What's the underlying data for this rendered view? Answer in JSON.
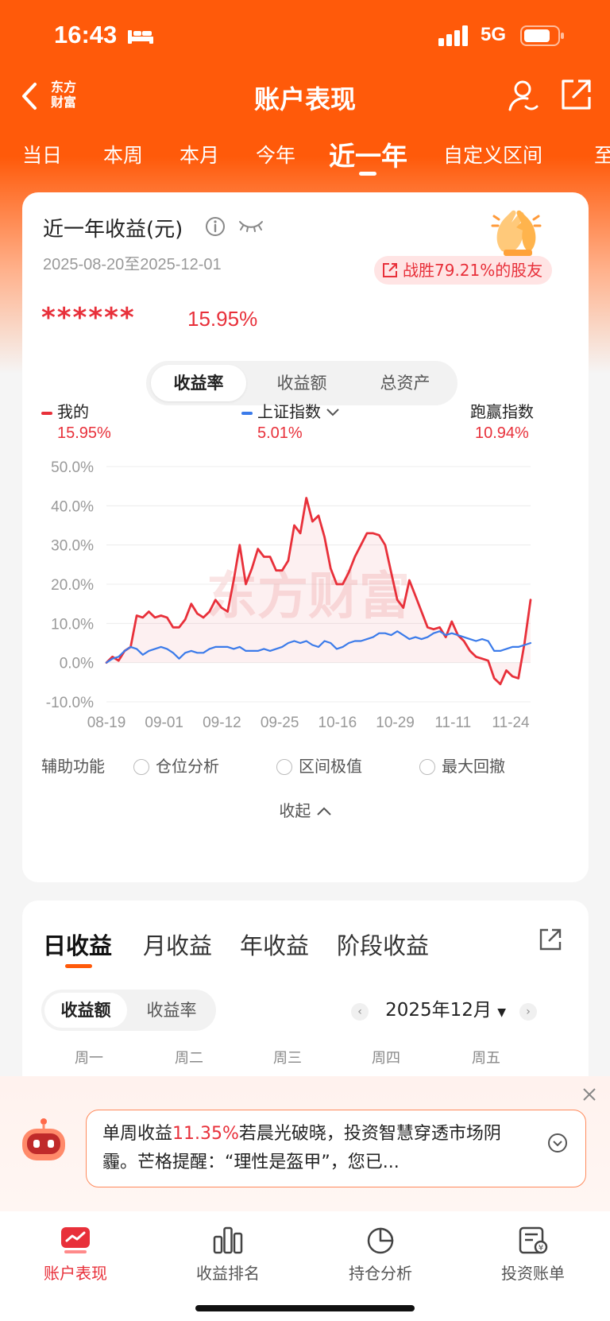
{
  "status_bar": {
    "time": "16:43",
    "network": "5G"
  },
  "nav": {
    "logo": "东方\n财富",
    "title": "账户表现"
  },
  "period_tabs": [
    "当日",
    "本周",
    "本月",
    "今年",
    "近一年",
    "自定义区间",
    "至"
  ],
  "active_period": "近一年",
  "summary": {
    "title": "近一年收益(元)",
    "date_range": "2025-08-20至2025-12-01",
    "win_badge": "战胜79.21%的股友",
    "hidden_amount": "******",
    "return_rate": "15.95%"
  },
  "metric_tabs": [
    "收益率",
    "收益额",
    "总资产"
  ],
  "legend": {
    "mine_label": "我的",
    "mine_value": "15.95%",
    "index_label": "上证指数",
    "index_value": "5.01%",
    "beat_label": "跑赢指数",
    "beat_value": "10.94%"
  },
  "chart_data": {
    "type": "line",
    "yticks": [
      "50.0%",
      "40.0%",
      "30.0%",
      "20.0%",
      "10.0%",
      "0.0%",
      "-10.0%"
    ],
    "xticks": [
      "08-19",
      "09-01",
      "09-12",
      "09-25",
      "10-16",
      "10-29",
      "11-11",
      "11-24"
    ],
    "ylim": [
      -10,
      50
    ],
    "watermark": "东方财富",
    "series": [
      {
        "name": "我的",
        "color": "#e8303a",
        "values": [
          0,
          1.5,
          0.5,
          3,
          4,
          12,
          11.5,
          13,
          11.5,
          12,
          11.5,
          9,
          9,
          11,
          15,
          12.5,
          11.5,
          13,
          16,
          14,
          13,
          21,
          30,
          20,
          24,
          29,
          27,
          27,
          23.5,
          23.5,
          26,
          35,
          33,
          42,
          36,
          37.5,
          32,
          24,
          20,
          20,
          23,
          27,
          30,
          33,
          33,
          32.5,
          30,
          23,
          16,
          14,
          21,
          17,
          13,
          9,
          8.5,
          9,
          6.5,
          10.5,
          7,
          5.5,
          3,
          1.5,
          1,
          0.5,
          -4,
          -5.5,
          -2,
          -3.5,
          -4,
          5,
          16
        ]
      },
      {
        "name": "上证指数",
        "color": "#3b7bea",
        "values": [
          0,
          1,
          1.5,
          3,
          4,
          3.5,
          2,
          3,
          3.5,
          4,
          3.5,
          2.5,
          1,
          2.5,
          3,
          2.5,
          2.5,
          3.5,
          4,
          4,
          4,
          3.5,
          4,
          3,
          3,
          3,
          3.5,
          3,
          3.5,
          4,
          5,
          5.5,
          5,
          5.5,
          4.5,
          4,
          5.5,
          5,
          3.5,
          4,
          5,
          5.5,
          5.5,
          6,
          6.5,
          7.5,
          7.5,
          7,
          8,
          7,
          6,
          6.5,
          6,
          6.5,
          7.5,
          8,
          7,
          7.5,
          7,
          6.5,
          6,
          5.5,
          6,
          5.5,
          3,
          3,
          3.5,
          4,
          4,
          4.5,
          5
        ]
      }
    ]
  },
  "aux": {
    "label": "辅助功能",
    "options": [
      "仓位分析",
      "区间极值",
      "最大回撤"
    ],
    "collapse": "收起"
  },
  "daily": {
    "tabs": [
      "日收益",
      "月收益",
      "年收益",
      "阶段收益"
    ],
    "seg": [
      "收益额",
      "收益率"
    ],
    "month": "2025年12月",
    "weekdays": [
      "周一",
      "周二",
      "周三",
      "周四",
      "周五"
    ]
  },
  "promo": {
    "text_prefix": "单周收益",
    "highlight": "11.35%",
    "text_suffix": "若晨光破晓，投资智慧穿透市场阴霾。芒格提醒：“理性是盔甲”，您已..."
  },
  "bottom_nav": [
    "账户表现",
    "收益排名",
    "持仓分析",
    "投资账单"
  ],
  "colors": {
    "brand": "#ff5a0a",
    "up_red": "#e8303a",
    "index_blue": "#3b7bea"
  }
}
